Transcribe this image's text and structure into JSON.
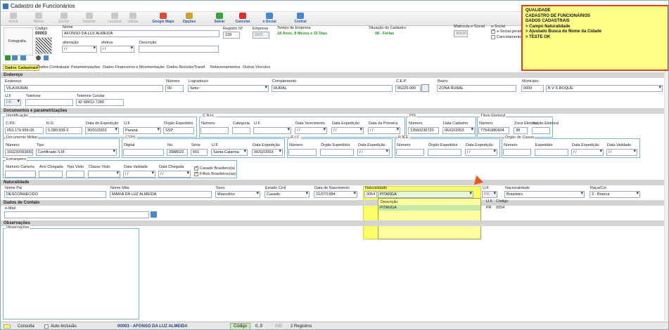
{
  "window": {
    "title": "Cadastro de Funcionários"
  },
  "toolbar": {
    "items": [
      "Incluir",
      "Alterar",
      "Excluir",
      "Imprimir",
      "Localizar",
      "Validar",
      "Google Maps",
      "Opções",
      "Salvar",
      "Cancelar",
      "e-Social",
      "Central"
    ]
  },
  "header": {
    "photo_label": "Fotografia",
    "codigo_label": "Código",
    "codigo_value": "00003",
    "nome_label": "Nome",
    "nome_value": "AFONSO DA LUZ ALMEIDA",
    "registro_label": "Registro Nº",
    "registro_value": "139",
    "empresa_label": "Empresa",
    "empresa_value": "0001",
    "tempo_label": "Tempo de Empresa",
    "tempo_value": "18 Anos, 8 Meses  e 15 Dias",
    "situacao_label": "Situação do Cadastro",
    "situacao_value": "08 - Férias",
    "matricula_label": "Matrícula e-Social",
    "matricula_value": "00030",
    "esocial_label": "e-Social",
    "esocial_gerado": "e-Social gerado",
    "cancelamento": "Cancelamento",
    "alteracao_label": "alteração",
    "alteracao_value": "/ /",
    "efetiva_label": "efetiva",
    "efetiva_value": "/ /",
    "descricao_label": "Descrição"
  },
  "note": {
    "lines": [
      "QUALIDADE",
      "CADASTRO DE FUNCIONÁRIOS",
      "DADOS CADASTRAIS",
      "",
      "> Campo Naturalidade",
      "",
      "> Ajustado Busca do Nome da Cidade",
      "",
      "> TESTE OK"
    ]
  },
  "tabs": [
    "Dados Cadastrais",
    "Dados Contratuais",
    "Parametrizações",
    "Dados Financeiros e Movimentação",
    "Dados Recisão/Transf",
    "Relacionamentos",
    "Outros Vínculos"
  ],
  "endereco": {
    "section": "Endereço",
    "endereco_label": "Endereço",
    "endereco_value": "VILA RURAL",
    "numero_label": "Número",
    "numero_value": "00",
    "logradouro_label": "Logradouro",
    "logradouro_value": "Setor",
    "complemento_label": "Complemento",
    "complemento_value": "RURAL",
    "cep_label": "C.E.P.",
    "cep_value": "85225-000",
    "bairro_label": "Bairro",
    "bairro_value": "ZONA RURAL",
    "municipio_label": "Município",
    "municipio_code": "0009",
    "municipio_value": "B V S ROQUE",
    "uf_label": "U.F.",
    "uf_value": "PR",
    "telefone_label": "Telefone",
    "celular_label": "Telefone Celular",
    "celular_value": "42 98412-7280"
  },
  "documentos": {
    "section": "Documentos e parametrizações",
    "ident_title": "Identificação",
    "cpf_label": "C.P.F.",
    "cpf_value": "053.179.959-06",
    "rg_label": "R.G.",
    "rg_value": "5.280.509-3",
    "dexp_label": "Data de Expedição",
    "dexp_value": "30/01/2003",
    "uf_label": "U.F.",
    "uf_value": "Paraná",
    "orgao_label": "Órgão Expedidor",
    "orgao_value": "SSP",
    "cnh_title": "C.N.H.",
    "cnh_numero": "Número",
    "cnh_categoria": "Categoria",
    "cnh_uf": "U.F.",
    "cnh_venc": "Data Vencimento",
    "cnh_exp": "Data Expedição",
    "cnh_primeira": "Data da Primeira",
    "date_empty": "/ /",
    "pis_title": "PIS",
    "pis_numero_label": "Número",
    "pis_numero": "13560230720",
    "pis_data_label": "Data Cadastro",
    "pis_data": "06/02/2003",
    "titulo_title": "Título Eleitoral",
    "titulo_numero_label": "Número",
    "titulo_numero": "77541880604",
    "zona_label": "Zona Eleitoral",
    "zona_value": "38",
    "secao_label": "Seção Eleitoral",
    "militar_title": "Documento Militar",
    "militar_numero_label": "Número",
    "militar_numero": "160232093650",
    "militar_tipo_label": "Tipo",
    "militar_tipo": "Certificado S.M.",
    "ctps_title": "CTPS",
    "ctps_digital": "Digital",
    "ctps_no_label": "No.",
    "ctps_no": "3988022",
    "ctps_serie_label": "Série",
    "ctps_serie": "001",
    "ctps_uf_label": "U.F.",
    "ctps_uf": "Santa Catarina",
    "ctps_dexp_label": "Data Expedição",
    "ctps_dexp": "06/02/2003",
    "ric_title": "R.I.C.",
    "ric_numero": "Número",
    "ric_orgao": "Órgão Expedidor",
    "ric_dexp": "Data Expedição",
    "rne_title": "R.N.E.",
    "rne_numero": "Número",
    "rne_orgao": "Órgão Expedidor",
    "rne_dexp": "Data Expedição",
    "classe_title": "Órgão de Classe",
    "classe_numero": "Número",
    "classe_exp": "Expedidor",
    "classe_dexp": "Data Expedição",
    "classe_val": "Data Validade",
    "estr_title": "Estrangeiro",
    "estr_carteira": "Número Carteira",
    "estr_ano": "Ano Chegada",
    "estr_tipo": "Tipo Visto",
    "estr_classe": "Classe Visto",
    "estr_validade": "Data Validade",
    "estr_chegada": "Data Chegada",
    "casado": "Casado Brasileiro(a)",
    "filhos": "Filhos Brasileiros(as)"
  },
  "naturalidade": {
    "section": "Naturalidade",
    "pai_label": "Nome Pai",
    "pai_value": "DESCONHECIDO",
    "mae_label": "Nome Mãe",
    "mae_value": "MARIA DA LUZ ALMEIDA",
    "sexo_label": "Sexo",
    "sexo_value": "Masculino",
    "civil_label": "Estado Civil",
    "civil_value": "Casado",
    "nasc_label": "Data de Nascimento",
    "nasc_value": "21/07/1984",
    "nat_label": "Naturalidade",
    "nat_code": "0054",
    "nat_value": "PITANGA",
    "uf_label": "U.F.",
    "uf_value": "PR",
    "nac_label": "Nacionalidade",
    "nac_value": "Brasileiro",
    "raca_label": "Raça/Cor",
    "raca_value": "2 - Branca",
    "popup_headers": [
      "Descrição",
      "U.F.",
      "Código"
    ],
    "popup_row": [
      "PITANGA",
      "PR",
      "0054"
    ]
  },
  "contato": {
    "section": "Dados de Contato",
    "email_label": "e-Mail"
  },
  "observacoes": {
    "section": "Observações",
    "box_title": "Observações"
  },
  "status": {
    "mode": "Consulta",
    "auto_inclusao": "Auto-Inclusão",
    "record": "00003 - AFONSO DA LUZ ALMEIDA",
    "codigo": "Código",
    "range": "0..9",
    "ins": "INS",
    "count": "2 Registros"
  }
}
